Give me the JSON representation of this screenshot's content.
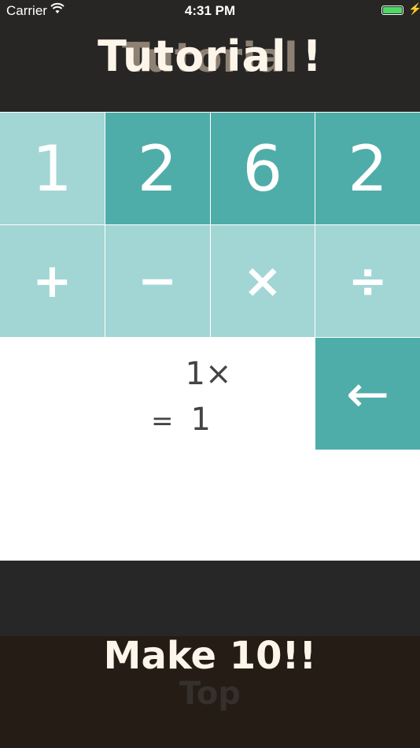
{
  "status_bar": {
    "carrier": "Carrier",
    "time": "4:31 PM",
    "battery_color": "#4cd964",
    "icons": [
      "wifi-icon",
      "battery-icon",
      "charging-bolt-icon"
    ]
  },
  "header": {
    "title": "Tutorial !",
    "ghost_text": "Tutorial"
  },
  "numbers": [
    {
      "value": "1",
      "state": "used"
    },
    {
      "value": "2",
      "state": "available"
    },
    {
      "value": "6",
      "state": "available"
    },
    {
      "value": "2",
      "state": "available"
    }
  ],
  "operators": [
    "+",
    "−",
    "×",
    "÷"
  ],
  "expression": {
    "line1": "1×",
    "equals": "=",
    "result": "1"
  },
  "backspace": {
    "label": "←",
    "icon": "back-arrow-icon"
  },
  "footer": {
    "title": "Make 10!!",
    "ghost_text": "Top"
  },
  "colors": {
    "tile_light": "#a2d6d4",
    "tile_dark": "#4fada9",
    "header_bg": "#272625",
    "footer_bg": "#241c15",
    "title_text": "#fdf5ea"
  }
}
